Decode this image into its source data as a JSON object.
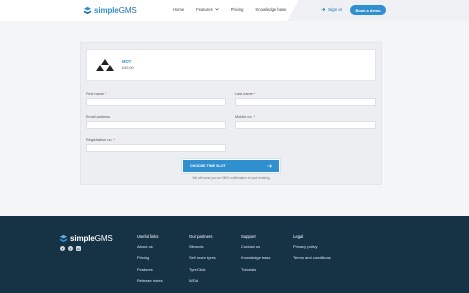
{
  "header": {
    "logo": {
      "brand_a": "simple",
      "brand_b": "GMS"
    },
    "nav": [
      {
        "label": "Home"
      },
      {
        "label": "Features"
      },
      {
        "label": "Pricing"
      },
      {
        "label": "Knowledge base"
      }
    ],
    "sign_in": "Sign in",
    "book_demo": "Book a demo"
  },
  "product": {
    "name": "MOT",
    "price": "£40.00"
  },
  "form": {
    "first_name_label": "First name",
    "last_name_label": "Last name",
    "email_label": "Email address",
    "mobile_label": "Mobile no.",
    "registration_label": "Registration no.",
    "required_mark": "*",
    "cta_label": "CHOOSE TIME SLOT",
    "cta_note": "We will send you an SMS confirmation of your booking"
  },
  "footer": {
    "logo": {
      "brand_a": "simple",
      "brand_b": "GMS"
    },
    "columns": [
      {
        "title": "Useful links",
        "links": [
          "About us",
          "Pricing",
          "Features",
          "Release notes"
        ]
      },
      {
        "title": "Our partners",
        "links": [
          "Sibonds",
          "Sell more tyres",
          "TyreClick",
          "WDA"
        ]
      },
      {
        "title": "Support",
        "links": [
          "Contact us",
          "Knowledge base",
          "Tutorials"
        ]
      },
      {
        "title": "Legal",
        "links": [
          "Privacy policy",
          "Terms and conditions"
        ]
      }
    ]
  },
  "colors": {
    "brand_blue": "#2f8fcf",
    "footer_bg": "#163346",
    "required": "#e23b3b"
  }
}
